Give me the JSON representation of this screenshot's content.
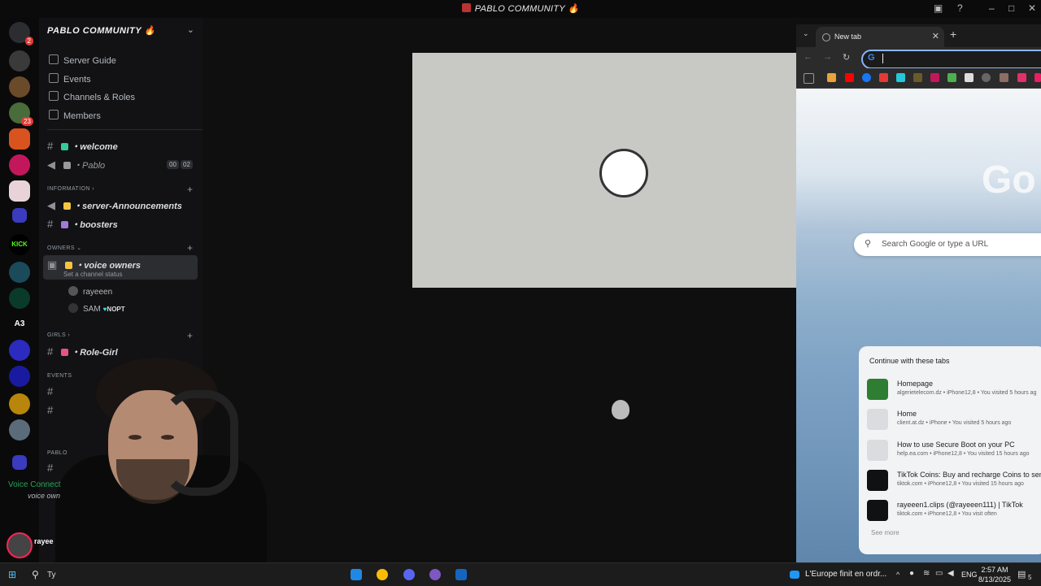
{
  "window": {
    "title": "PABLO COMMUNITY 🔥"
  },
  "server": {
    "name": "PABLO COMMUNITY 🔥",
    "nav": [
      "Server Guide",
      "Events",
      "Channels & Roles",
      "Members"
    ],
    "channels": {
      "welcome": "・welcome",
      "pablo": "・Pablo",
      "pablo_counts": [
        "00",
        "02"
      ],
      "cat_information": "INFORMATION",
      "announcements": "・server-Announcements",
      "boosters": "・boosters",
      "cat_owners": "OWNERS",
      "voice_owners": "・voice owners",
      "channel_status": "Set a channel status",
      "members": [
        "rayeeen",
        "SAM"
      ],
      "sam_tag": "NOPT",
      "cat_girls": "GIRLS",
      "role_girl": "・Role-Girl",
      "cat_events": "EVENTS",
      "cat_pablo": "PABLO"
    },
    "rail_badges": [
      "2",
      "23"
    ],
    "kick_label": "KICK",
    "a3_label": "A3",
    "voice_connected": "Voice Connect",
    "voice_channel": "voice own",
    "user": "rayee"
  },
  "browser": {
    "tab_title": "New tab",
    "search_placeholder": "Search Google or type a URL",
    "google_partial": "Go",
    "continue_heading": "Continue with these tabs",
    "recent": [
      {
        "title": "Homepage",
        "sub": "algerietelecom.dz • iPhone12,8 • You visited 5 hours ag"
      },
      {
        "title": "Home",
        "sub": "client.at.dz • iPhone • You visited 5 hours ago"
      },
      {
        "title": "How to use Secure Boot on your PC",
        "sub": "help.ea.com • iPhone12,8 • You visited 15 hours ago"
      },
      {
        "title": "TikTok Coins: Buy and recharge Coins to send",
        "sub": "tiktok.com • iPhone12,8 • You visited 15 hours ago"
      },
      {
        "title": "rayeeen1.clips (@rayeeen111) | TikTok",
        "sub": "tiktok.com • iPhone12,8 • You visit often"
      }
    ],
    "see_more": "See more"
  },
  "taskbar": {
    "search": "Ty",
    "news": "L'Europe finit en ordr...",
    "lang": "ENG",
    "time": "2:57 AM",
    "date": "8/13/2025",
    "notif": "5"
  }
}
